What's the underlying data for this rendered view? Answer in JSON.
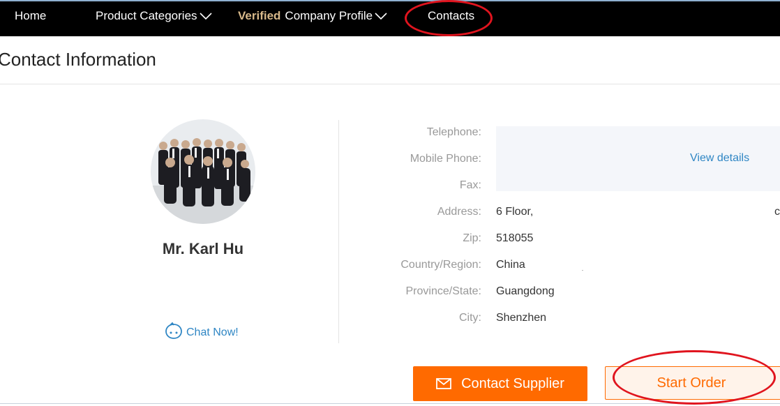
{
  "nav": {
    "home": "Home",
    "product_categories": "Product Categories",
    "verified": "Verified",
    "company_profile": "Company Profile",
    "contacts": "Contacts"
  },
  "section_title": "Contact Information",
  "contact": {
    "name": "Mr. Karl Hu",
    "chat_label": "Chat Now!"
  },
  "info": {
    "telephone_label": "Telephone:",
    "mobile_label": "Mobile Phone:",
    "fax_label": "Fax:",
    "view_details": "View details",
    "address_label": "Address:",
    "address_value": "6 Floor,",
    "address_extra": "c",
    "zip_label": "Zip:",
    "zip_value": "518055",
    "country_label": "Country/Region:",
    "country_value": "China",
    "province_label": "Province/State:",
    "province_value": "Guangdong",
    "city_label": "City:",
    "city_value": "Shenzhen"
  },
  "buttons": {
    "contact_supplier": "Contact Supplier",
    "start_order": "Start Order"
  },
  "colors": {
    "nav_bg": "#000000",
    "accent_orange": "#ff6a00",
    "link_blue": "#2f86c4",
    "verified_gold": "#d8b98a",
    "annotation_red": "#e0141e"
  },
  "icons": [
    "chevron-down-icon",
    "chat-bubble-icon",
    "envelope-icon"
  ]
}
